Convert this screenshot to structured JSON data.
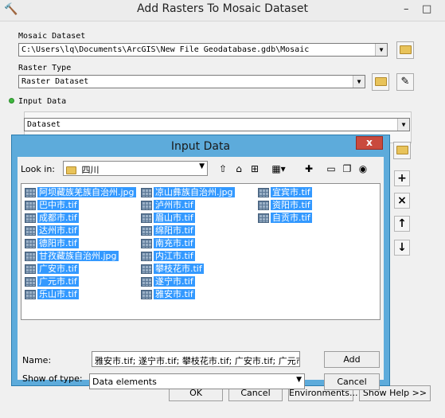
{
  "window": {
    "title": "Add Rasters To Mosaic Dataset",
    "controls": [
      "–",
      "□"
    ]
  },
  "mosaic": {
    "label": "Mosaic Dataset",
    "value": "C:\\Users\\lq\\Documents\\ArcGIS\\New File Geodatabase.gdb\\Mosaic"
  },
  "raster_type": {
    "label": "Raster Type",
    "value": "Raster Dataset"
  },
  "input_data": {
    "label": "Input Data",
    "combo_value": "Dataset"
  },
  "side_buttons": [
    "+",
    "×",
    "↑",
    "↓"
  ],
  "bottom_buttons": {
    "ok": "OK",
    "cancel": "Cancel",
    "environments": "Environments...",
    "show_help": "Show Help >>"
  },
  "dialog": {
    "title": "Input Data",
    "close": "x",
    "look_in_label": "Look in:",
    "look_in_value": "四川",
    "files_col1": [
      "阿坝藏族羌族自治州.jpg",
      "巴中市.tif",
      "成都市.tif",
      "达州市.tif",
      "德阳市.tif",
      "甘孜藏族自治州.jpg",
      "广安市.tif",
      "广元市.tif",
      "乐山市.tif"
    ],
    "files_col2": [
      "凉山彝族自治州.jpg",
      "泸州市.tif",
      "眉山市.tif",
      "绵阳市.tif",
      "南充市.tif",
      "内江市.tif",
      "攀枝花市.tif",
      "遂宁市.tif",
      "雅安市.tif"
    ],
    "files_col3": [
      "宜宾市.tif",
      "资阳市.tif",
      "自贡市.tif"
    ],
    "name_label": "Name:",
    "name_value": "雅安市.tif; 遂宁市.tif; 攀枝花市.tif; 广安市.tif; 广元市.t",
    "type_label": "Show of type:",
    "type_value": "Data elements",
    "add_button": "Add",
    "cancel_button": "Cancel"
  },
  "colors": {
    "dialog_border": "#5dabdb",
    "selection": "#3399ff",
    "close_button": "#c94a3d"
  }
}
